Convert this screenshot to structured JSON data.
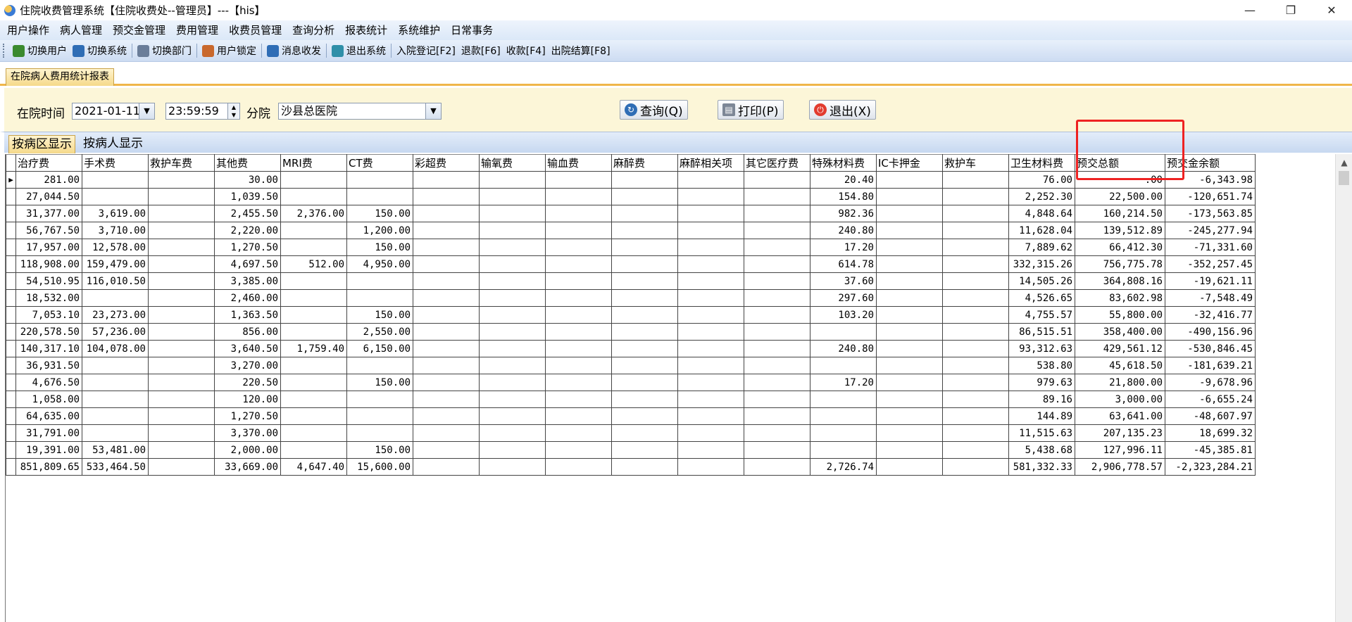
{
  "window": {
    "title": "住院收费管理系统【住院收费处--管理员】---【his】",
    "minimize": "—",
    "restore": "❐",
    "close": "✕"
  },
  "menu": [
    "用户操作",
    "病人管理",
    "预交金管理",
    "费用管理",
    "收费员管理",
    "查询分析",
    "报表统计",
    "系统维护",
    "日常事务"
  ],
  "toolbar": [
    {
      "label": "切换用户",
      "icon": "users-icon",
      "color": "#3b8a2e"
    },
    {
      "label": "切换系统",
      "icon": "switch-system-icon",
      "color": "#2f6db5"
    },
    {
      "label": "切换部门",
      "icon": "department-icon",
      "color": "#6a7d99"
    },
    {
      "label": "用户锁定",
      "icon": "user-lock-icon",
      "color": "#c9682c"
    },
    {
      "label": "消息收发",
      "icon": "info-icon",
      "color": "#2f6db5"
    },
    {
      "label": "退出系统",
      "icon": "exit-icon",
      "color": "#2f8fa8"
    },
    {
      "label": "入院登记[F2]",
      "icon": ""
    },
    {
      "label": "退款[F6]",
      "icon": ""
    },
    {
      "label": "收款[F4]",
      "icon": ""
    },
    {
      "label": "出院结算[F8]",
      "icon": ""
    }
  ],
  "doc_tab": "在院病人费用统计报表",
  "filter": {
    "time_label": "在院时间",
    "date": "2021-01-11",
    "time": "23:59:59",
    "branch_label": "分院",
    "branch": "沙县总医院",
    "query": "查询(Q)",
    "print": "打印(P)",
    "exit": "退出(X)"
  },
  "subtabs": [
    "按病区显示",
    "按病人显示"
  ],
  "table": {
    "headers": [
      "治疗费",
      "手术费",
      "救护车费",
      "其他费",
      "MRI费",
      "CT费",
      "彩超费",
      "输氧费",
      "输血费",
      "麻醉费",
      "麻醉相关项",
      "其它医疗费",
      "特殊材料费",
      "IC卡押金",
      "救护车",
      "卫生材料费",
      "预交总额",
      "预交金余额"
    ],
    "rows": [
      [
        "281.00",
        "",
        "",
        "30.00",
        "",
        "",
        "",
        "",
        "",
        "",
        "",
        "",
        "20.40",
        "",
        "",
        "76.00",
        ".00",
        "-6,343.98"
      ],
      [
        "27,044.50",
        "",
        "",
        "1,039.50",
        "",
        "",
        "",
        "",
        "",
        "",
        "",
        "",
        "154.80",
        "",
        "",
        "2,252.30",
        "22,500.00",
        "-120,651.74"
      ],
      [
        "31,377.00",
        "3,619.00",
        "",
        "2,455.50",
        "2,376.00",
        "150.00",
        "",
        "",
        "",
        "",
        "",
        "",
        "982.36",
        "",
        "",
        "4,848.64",
        "160,214.50",
        "-173,563.85"
      ],
      [
        "56,767.50",
        "3,710.00",
        "",
        "2,220.00",
        "",
        "1,200.00",
        "",
        "",
        "",
        "",
        "",
        "",
        "240.80",
        "",
        "",
        "11,628.04",
        "139,512.89",
        "-245,277.94"
      ],
      [
        "17,957.00",
        "12,578.00",
        "",
        "1,270.50",
        "",
        "150.00",
        "",
        "",
        "",
        "",
        "",
        "",
        "17.20",
        "",
        "",
        "7,889.62",
        "66,412.30",
        "-71,331.60"
      ],
      [
        "118,908.00",
        "159,479.00",
        "",
        "4,697.50",
        "512.00",
        "4,950.00",
        "",
        "",
        "",
        "",
        "",
        "",
        "614.78",
        "",
        "",
        "332,315.26",
        "756,775.78",
        "-352,257.45"
      ],
      [
        "54,510.95",
        "116,010.50",
        "",
        "3,385.00",
        "",
        "",
        "",
        "",
        "",
        "",
        "",
        "",
        "37.60",
        "",
        "",
        "14,505.26",
        "364,808.16",
        "-19,621.11"
      ],
      [
        "18,532.00",
        "",
        "",
        "2,460.00",
        "",
        "",
        "",
        "",
        "",
        "",
        "",
        "",
        "297.60",
        "",
        "",
        "4,526.65",
        "83,602.98",
        "-7,548.49"
      ],
      [
        "7,053.10",
        "23,273.00",
        "",
        "1,363.50",
        "",
        "150.00",
        "",
        "",
        "",
        "",
        "",
        "",
        "103.20",
        "",
        "",
        "4,755.57",
        "55,800.00",
        "-32,416.77"
      ],
      [
        "220,578.50",
        "57,236.00",
        "",
        "856.00",
        "",
        "2,550.00",
        "",
        "",
        "",
        "",
        "",
        "",
        "",
        "",
        "",
        "86,515.51",
        "358,400.00",
        "-490,156.96"
      ],
      [
        "140,317.10",
        "104,078.00",
        "",
        "3,640.50",
        "1,759.40",
        "6,150.00",
        "",
        "",
        "",
        "",
        "",
        "",
        "240.80",
        "",
        "",
        "93,312.63",
        "429,561.12",
        "-530,846.45"
      ],
      [
        "36,931.50",
        "",
        "",
        "3,270.00",
        "",
        "",
        "",
        "",
        "",
        "",
        "",
        "",
        "",
        "",
        "",
        "538.80",
        "45,618.50",
        "-181,639.21"
      ],
      [
        "4,676.50",
        "",
        "",
        "220.50",
        "",
        "150.00",
        "",
        "",
        "",
        "",
        "",
        "",
        "17.20",
        "",
        "",
        "979.63",
        "21,800.00",
        "-9,678.96"
      ],
      [
        "1,058.00",
        "",
        "",
        "120.00",
        "",
        "",
        "",
        "",
        "",
        "",
        "",
        "",
        "",
        "",
        "",
        "89.16",
        "3,000.00",
        "-6,655.24"
      ],
      [
        "64,635.00",
        "",
        "",
        "1,270.50",
        "",
        "",
        "",
        "",
        "",
        "",
        "",
        "",
        "",
        "",
        "",
        "144.89",
        "63,641.00",
        "-48,607.97"
      ],
      [
        "31,791.00",
        "",
        "",
        "3,370.00",
        "",
        "",
        "",
        "",
        "",
        "",
        "",
        "",
        "",
        "",
        "",
        "11,515.63",
        "207,135.23",
        "18,699.32"
      ],
      [
        "19,391.00",
        "53,481.00",
        "",
        "2,000.00",
        "",
        "150.00",
        "",
        "",
        "",
        "",
        "",
        "",
        "",
        "",
        "",
        "5,438.68",
        "127,996.11",
        "-45,385.81"
      ],
      [
        "851,809.65",
        "533,464.50",
        "",
        "33,669.00",
        "4,647.40",
        "15,600.00",
        "",
        "",
        "",
        "",
        "",
        "",
        "2,726.74",
        "",
        "",
        "581,332.33",
        "2,906,778.57",
        "-2,323,284.21"
      ]
    ]
  },
  "colors": {
    "highlight": "#ee2222",
    "tab_accent": "#f0b64a",
    "panel_bg": "#fcf6d8"
  }
}
